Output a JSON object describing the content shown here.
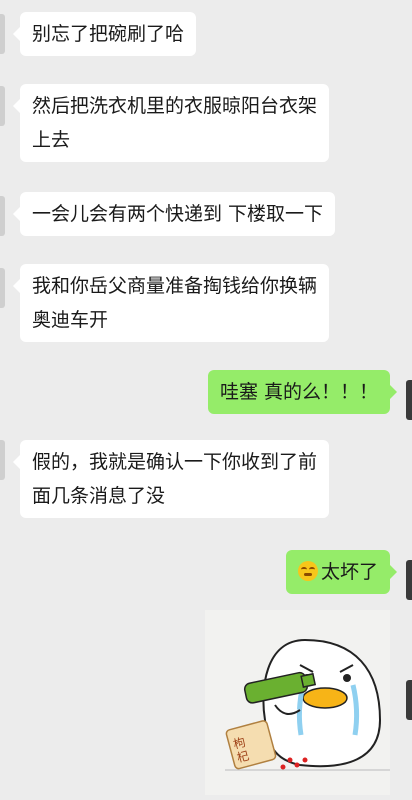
{
  "messages": [
    {
      "side": "left",
      "lines": [
        "别忘了把碗刷了哈"
      ]
    },
    {
      "side": "left",
      "lines": [
        "然后把洗衣机里的衣服晾阳台衣架",
        "上去"
      ]
    },
    {
      "side": "left",
      "lines": [
        "一会儿会有两个快递到 下楼取一下"
      ]
    },
    {
      "side": "left",
      "lines": [
        "我和你岳父商量准备掏钱给你换辆",
        "奥迪车开"
      ]
    },
    {
      "side": "right",
      "lines": [
        "哇塞 真的么！！！"
      ]
    },
    {
      "side": "left",
      "lines": [
        "假的，我就是确认一下你收到了前",
        "面几条消息了没"
      ]
    },
    {
      "side": "right",
      "lines": [
        "太坏了"
      ],
      "emoji": "grimacing-face"
    }
  ],
  "sticker": {
    "label": "枸杞",
    "description": "crying-duck-sticker"
  },
  "colors": {
    "background": "#ececec",
    "incoming_bubble": "#ffffff",
    "outgoing_bubble": "#95ec69"
  }
}
